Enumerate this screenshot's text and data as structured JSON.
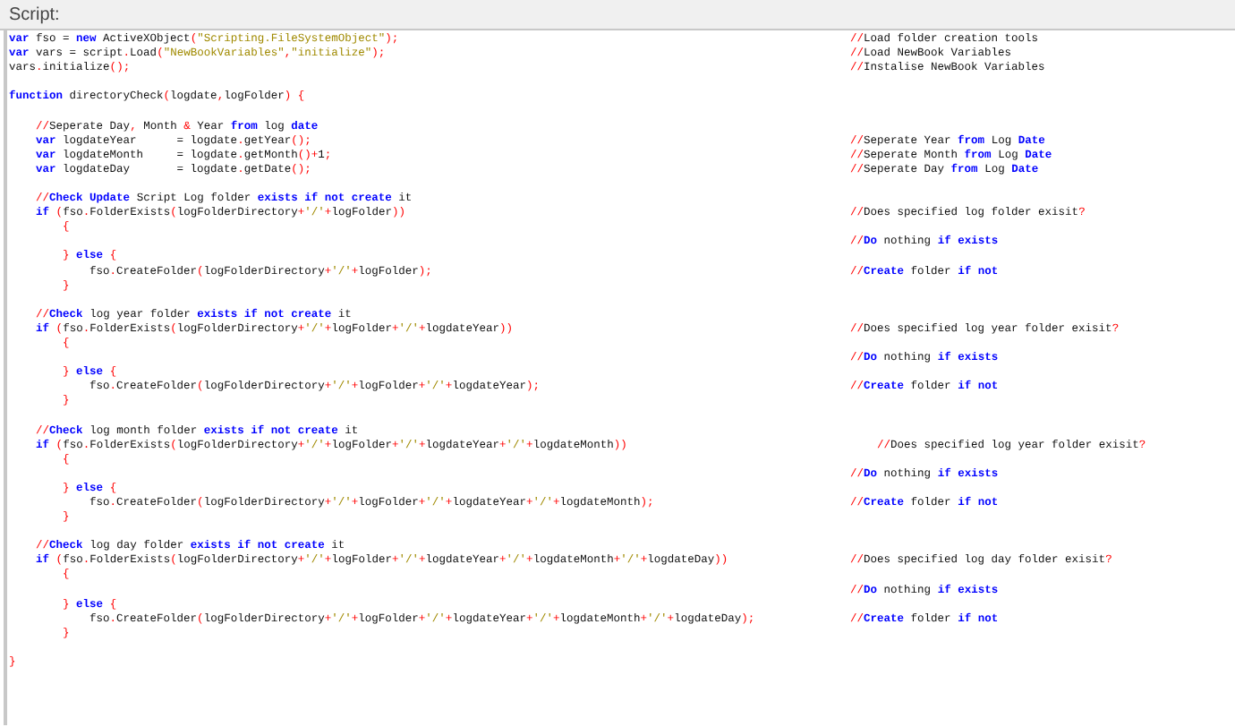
{
  "panel": {
    "title": "Script:"
  },
  "blocks": [
    {
      "lines": [
        {
          "code": "**var** fso = **new** ActiveXObject(\"Scripting.FileSystemObject\");",
          "comment": "//Load folder creation tools"
        },
        {
          "code": "**var** vars = script.Load(\"NewBookVariables\",\"initialize\");",
          "comment": "//Load NewBook Variables"
        },
        {
          "code": "vars.initialize();",
          "comment": "//Instalise NewBook Variables"
        }
      ]
    },
    {
      "lines": [
        {
          "code": "**function** directoryCheck(logdate,logFolder) {"
        }
      ]
    },
    {
      "lines": [
        {
          "code": "    //Seperate Day, Month & Year **from** log **date**"
        },
        {
          "code": "    **var** logdateYear      = logdate.getYear();",
          "comment": "//Seperate Year **from** Log **Date**"
        },
        {
          "code": "    **var** logdateMonth     = logdate.getMonth()+1;",
          "comment": "//Seperate Month **from** Log **Date**"
        },
        {
          "code": "    **var** logdateDay       = logdate.getDate();",
          "comment": "//Seperate Day **from** Log **Date**"
        }
      ]
    },
    {
      "lines": [
        {
          "code": "    //**Check Update** Script Log folder **exists if not create** it"
        },
        {
          "code": "    **if** (fso.FolderExists(logFolderDirectory+'/'+logFolder))",
          "comment": "//Does specified log folder exisit?"
        },
        {
          "code": "        {"
        },
        {
          "comment": "//**Do** nothing **if exists**"
        },
        {
          "code": "        } **else** {"
        },
        {
          "code": "            fso.CreateFolder(logFolderDirectory+'/'+logFolder);",
          "comment": "//**Create** folder **if not**"
        },
        {
          "code": "        }"
        }
      ]
    },
    {
      "lines": [
        {
          "code": "    //**Check** log year folder **exists if not create** it"
        },
        {
          "code": "    **if** (fso.FolderExists(logFolderDirectory+'/'+logFolder+'/'+logdateYear))",
          "comment": "//Does specified log year folder exisit?"
        },
        {
          "code": "        {"
        },
        {
          "comment": "//**Do** nothing **if exists**"
        },
        {
          "code": "        } **else** {"
        },
        {
          "code": "            fso.CreateFolder(logFolderDirectory+'/'+logFolder+'/'+logdateYear);",
          "comment": "//**Create** folder **if not**"
        },
        {
          "code": "        }"
        }
      ]
    },
    {
      "lines": [
        {
          "code": "    //**Check** log month folder **exists if not create** it"
        },
        {
          "code": "    **if** (fso.FolderExists(logFolderDirectory+'/'+logFolder+'/'+logdateYear+'/'+logdateMonth))",
          "comment": "    //Does specified log year folder exisit?"
        },
        {
          "code": "        {"
        },
        {
          "comment": "//**Do** nothing **if exists**"
        },
        {
          "code": "        } **else** {"
        },
        {
          "code": "            fso.CreateFolder(logFolderDirectory+'/'+logFolder+'/'+logdateYear+'/'+logdateMonth);",
          "comment": "//**Create** folder **if not**"
        },
        {
          "code": "        }"
        }
      ]
    },
    {
      "lines": [
        {
          "code": "    //**Check** log day folder **exists if not create** it"
        },
        {
          "code": "    **if** (fso.FolderExists(logFolderDirectory+'/'+logFolder+'/'+logdateYear+'/'+logdateMonth+'/'+logdateDay))",
          "comment": "//Does specified log day folder exisit?"
        },
        {
          "code": "        {"
        },
        {
          "comment": "//**Do** nothing **if exists**"
        },
        {
          "code": "        } **else** {"
        },
        {
          "code": "            fso.CreateFolder(logFolderDirectory+'/'+logFolder+'/'+logdateYear+'/'+logdateMonth+'/'+logdateDay);",
          "comment": "//**Create** folder **if not**"
        },
        {
          "code": "        }"
        }
      ]
    },
    {
      "lines": [
        {
          "code": "}"
        }
      ]
    }
  ]
}
